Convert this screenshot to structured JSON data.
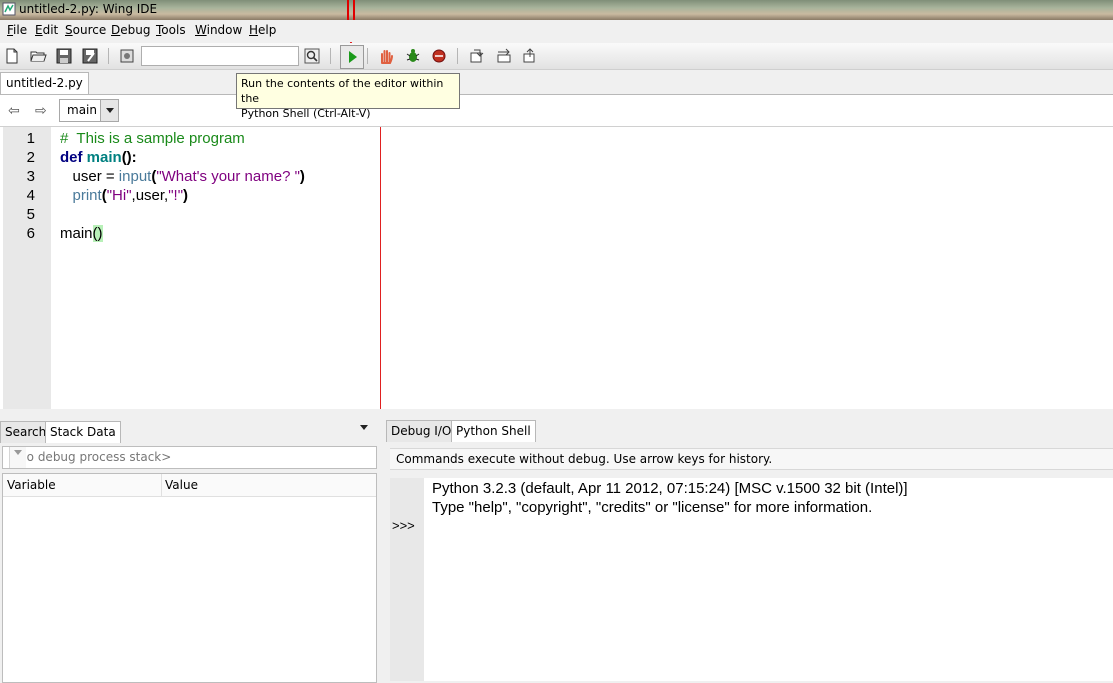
{
  "window": {
    "title": "untitled-2.py: Wing IDE"
  },
  "menu": [
    {
      "label": "File",
      "underline": "F",
      "rest": "ile"
    },
    {
      "label": "Edit",
      "underline": "E",
      "rest": "dit"
    },
    {
      "label": "Source",
      "underline": "S",
      "rest": "ource"
    },
    {
      "label": "Debug",
      "underline": "D",
      "rest": "ebug"
    },
    {
      "label": "Tools",
      "underline": "T",
      "rest": "ools"
    },
    {
      "label": "Window",
      "underline": "W",
      "rest": "indow"
    },
    {
      "label": "Help",
      "underline": "H",
      "rest": "elp"
    }
  ],
  "toolbar": {
    "search_value": "",
    "tooltip_line1": "Run the contents of the editor within the",
    "tooltip_line2": "Python Shell (Ctrl-Alt-V)"
  },
  "editor": {
    "tab_label": "untitled-2.py",
    "scope": "main",
    "line_numbers": [
      "1",
      "2",
      "3",
      "4",
      "5",
      "6"
    ],
    "lines": {
      "l1": "#  This is a sample program",
      "l2_kw": "def",
      "l2_name": "main",
      "l2_paren": "():",
      "l3_var": "user = ",
      "l3_fn": "input",
      "l3_open": "(",
      "l3_str": "\"What's your name? \"",
      "l3_close": ")",
      "l4_fn": "print",
      "l4_open": "(",
      "l4_str1": "\"Hi\"",
      "l4_mid": ",user,",
      "l4_str2": "\"!\"",
      "l4_close": ")",
      "l6_name": "main",
      "l6_paren": "()"
    }
  },
  "left_tool": {
    "tabs": [
      "Search",
      "Stack Data"
    ],
    "active_tab": "Stack Data",
    "stack_placeholder": "<no debug process stack>",
    "columns": [
      "Variable",
      "Value"
    ]
  },
  "right_tool": {
    "tabs": [
      "Debug I/O",
      "Python Shell"
    ],
    "active_tab": "Python Shell",
    "message": "Commands execute without debug.  Use arrow keys for history.",
    "output_line1": "Python 3.2.3 (default, Apr 11 2012, 07:15:24) [MSC v.1500 32 bit (Intel)]",
    "output_line2": "Type \"help\", \"copyright\", \"credits\" or \"license\" for more information.",
    "prompt": ">>>"
  },
  "colors": {
    "comment": "#1a8a1a",
    "keyword": "#000080",
    "string": "#7f007f",
    "edge_line": "#e02020",
    "annotation_arrow": "#e00000"
  },
  "icons": [
    "app-icon",
    "new-file-icon",
    "open-folder-icon",
    "save-icon",
    "save-all-icon",
    "settings-icon",
    "search-icon",
    "run-icon",
    "stop-icon",
    "debug-icon",
    "breakpoint-icon",
    "step-in-icon",
    "step-over-icon",
    "step-out-icon",
    "back-arrow-icon",
    "forward-arrow-icon",
    "annotation-arrow-icon"
  ]
}
